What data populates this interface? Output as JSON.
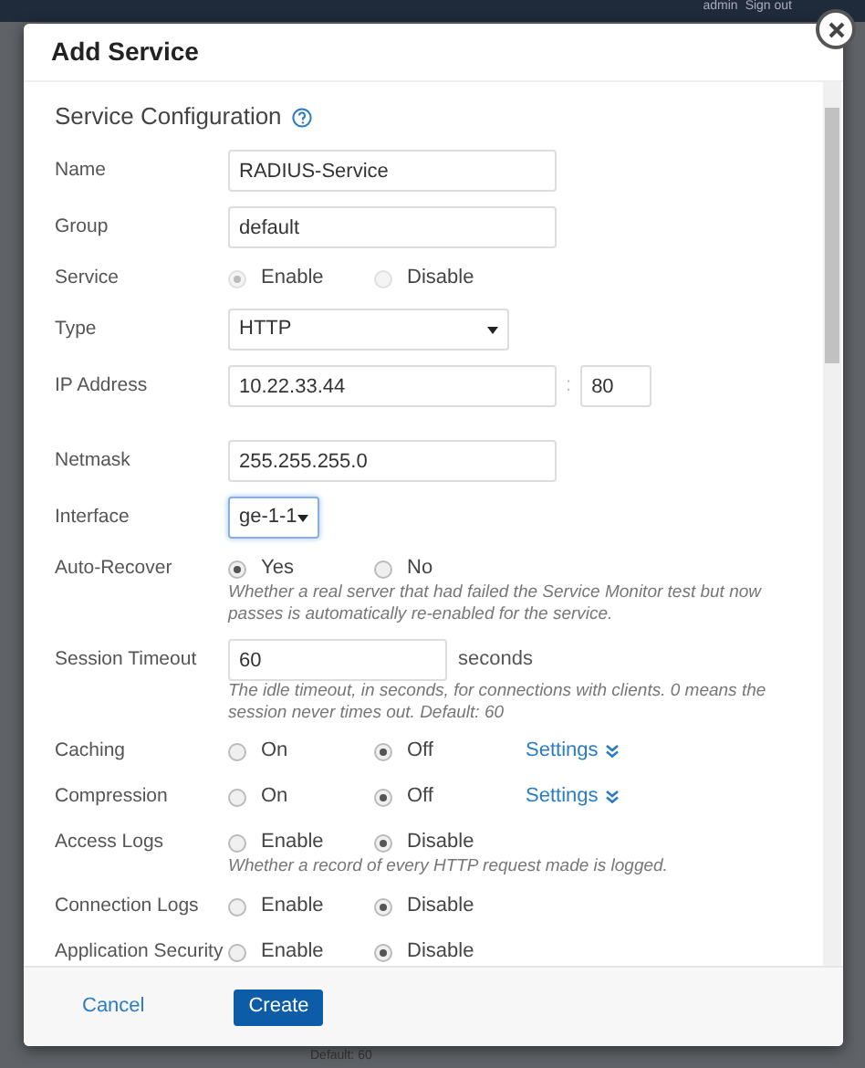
{
  "background": {
    "user": "admin",
    "sign_out": "Sign out",
    "note": "Default: 60"
  },
  "dialog": {
    "title": "Add Service",
    "section": "Service Configuration",
    "fields": [
      {
        "kind": "text",
        "label": "Name",
        "value": "RADIUS-Service"
      },
      {
        "kind": "text",
        "label": "Group",
        "value": "default"
      },
      {
        "kind": "radio",
        "label": "Service",
        "disabled": true,
        "options": [
          {
            "label": "Enable",
            "selected": true
          },
          {
            "label": "Disable",
            "selected": false
          }
        ]
      },
      {
        "kind": "select",
        "label": "Type",
        "value": "HTTP",
        "focused": false
      },
      {
        "kind": "address",
        "label": "IP Address",
        "value": "10.22.33.44",
        "separator": ":",
        "port": "80"
      },
      {
        "kind": "text",
        "label": "Netmask",
        "value": "255.255.255.0"
      },
      {
        "kind": "select-compact",
        "label": "Interface",
        "value": "ge-1-1",
        "focused": true
      },
      {
        "kind": "radio",
        "label": "Auto-Recover",
        "disabled": false,
        "options": [
          {
            "label": "Yes",
            "selected": true
          },
          {
            "label": "No",
            "selected": false
          }
        ],
        "hint": "Whether a real server that had failed the Service Monitor test but now passes is automatically re-enabled for the service."
      },
      {
        "kind": "number",
        "label": "Session Timeout",
        "value": "60",
        "unit": "seconds",
        "hint": "The idle timeout, in seconds, for connections with clients. 0 means the session never times out. Default: 60"
      },
      {
        "kind": "radio",
        "label": "Caching",
        "disabled": false,
        "options": [
          {
            "label": "On",
            "selected": false
          },
          {
            "label": "Off",
            "selected": true
          }
        ],
        "link": "Settings"
      },
      {
        "kind": "radio",
        "label": "Compression",
        "disabled": false,
        "options": [
          {
            "label": "On",
            "selected": false
          },
          {
            "label": "Off",
            "selected": true
          }
        ],
        "link": "Settings"
      },
      {
        "kind": "radio",
        "label": "Access Logs",
        "disabled": false,
        "options": [
          {
            "label": "Enable",
            "selected": false
          },
          {
            "label": "Disable",
            "selected": true
          }
        ],
        "hint": "Whether a record of every HTTP request made is logged."
      },
      {
        "kind": "radio",
        "label": "Connection Logs",
        "disabled": false,
        "options": [
          {
            "label": "Enable",
            "selected": false
          },
          {
            "label": "Disable",
            "selected": true
          }
        ]
      },
      {
        "kind": "radio",
        "label": "Application Security",
        "disabled": false,
        "options": [
          {
            "label": "Enable",
            "selected": false
          },
          {
            "label": "Disable",
            "selected": true
          }
        ]
      }
    ],
    "buttons": {
      "cancel": "Cancel",
      "create": "Create"
    }
  }
}
